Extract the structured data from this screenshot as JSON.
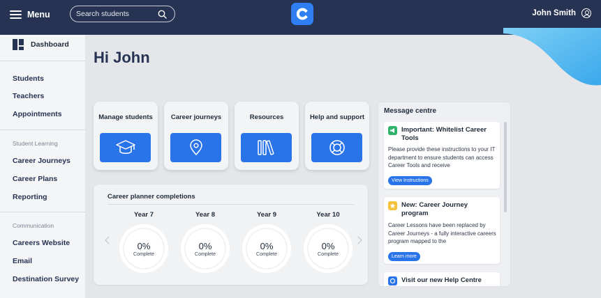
{
  "header": {
    "menu_label": "Menu",
    "search_placeholder": "Search students",
    "user_name": "John Smith",
    "accent": "#2f7ff3",
    "bar_color": "#273352"
  },
  "sidebar": {
    "dashboard": "Dashboard",
    "main_items": [
      "Students",
      "Teachers",
      "Appointments"
    ],
    "student_learning_heading": "Student Learning",
    "student_learning_items": [
      "Career Journeys",
      "Career Plans",
      "Reporting"
    ],
    "communication_heading": "Communication",
    "communication_items": [
      "Careers Website",
      "Email",
      "Destination Survey"
    ]
  },
  "main": {
    "greeting": "Hi John",
    "cards": [
      {
        "label": "Manage students",
        "icon": "graduation-cap-icon"
      },
      {
        "label": "Career journeys",
        "icon": "map-pin-icon"
      },
      {
        "label": "Resources",
        "icon": "books-icon"
      },
      {
        "label": "Help and support",
        "icon": "lifebuoy-icon"
      }
    ],
    "completions": {
      "title": "Career planner completions",
      "years": [
        {
          "label": "Year 7",
          "percent": "0%",
          "sub": "Complete"
        },
        {
          "label": "Year 8",
          "percent": "0%",
          "sub": "Complete"
        },
        {
          "label": "Year 9",
          "percent": "0%",
          "sub": "Complete"
        },
        {
          "label": "Year 10",
          "percent": "0%",
          "sub": "Complete"
        }
      ]
    }
  },
  "messages": {
    "title": "Message centre",
    "items": [
      {
        "heading": "Important: Whitelist Career Tools",
        "body": "Please provide these instructions to your IT department to ensure students can access Career Tools and receive",
        "link": "View Instructions",
        "badge_color": "#2fb36b"
      },
      {
        "heading": "New: Career Journey program",
        "body": "Career Lessons have been replaced by Career Journeys - a fully interactive careers program mapped to the",
        "link": "Learn more",
        "badge_color": "#f4c23d"
      },
      {
        "heading": "Visit our new Help Centre",
        "badge_color": "#2a74ea"
      }
    ]
  }
}
